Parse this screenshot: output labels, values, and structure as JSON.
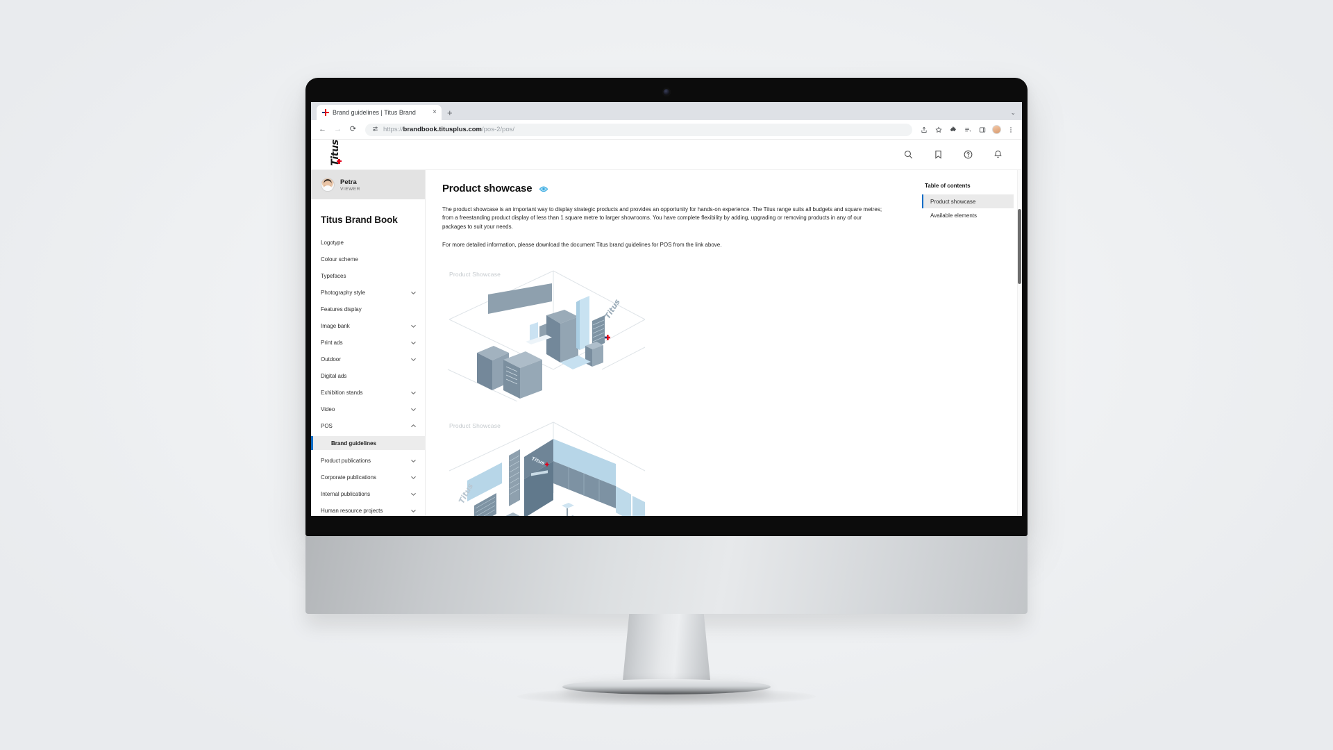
{
  "browser": {
    "tab": {
      "title": "Brand guidelines | Titus Brand",
      "favicon": "titus-cross-favicon",
      "close_label": "×"
    },
    "new_tab_label": "+",
    "tablist_chevron": "⌄",
    "nav": {
      "back": "←",
      "forward": "→",
      "reload": "⟳"
    },
    "omnibox": {
      "site_settings_icon": "tune-icon",
      "url_prefix": "https://",
      "url_domain": "brandbook.titusplus.com",
      "url_path": "/pos-2/pos/"
    },
    "toolbar_icons": [
      {
        "name": "share-icon",
        "glyph": "⇧"
      },
      {
        "name": "bookmark-star-icon",
        "glyph": "☆"
      },
      {
        "name": "extensions-puzzle-icon",
        "glyph": "❖"
      },
      {
        "name": "reading-list-icon",
        "glyph": "≣"
      },
      {
        "name": "side-panel-icon",
        "glyph": "▣"
      },
      {
        "name": "profile-avatar",
        "glyph": ""
      },
      {
        "name": "chrome-menu-icon",
        "glyph": "⋮"
      }
    ]
  },
  "app": {
    "logo_text": "Titus",
    "header_icons": [
      {
        "name": "search-icon"
      },
      {
        "name": "bookmark-icon"
      },
      {
        "name": "help-icon"
      },
      {
        "name": "notification-bell-icon"
      }
    ]
  },
  "sidebar": {
    "user": {
      "name": "Petra",
      "role": "VIEWER"
    },
    "title": "Titus Brand Book",
    "items": [
      {
        "label": "Logotype",
        "expandable": false
      },
      {
        "label": "Colour scheme",
        "expandable": false
      },
      {
        "label": "Typefaces",
        "expandable": false
      },
      {
        "label": "Photography style",
        "expandable": true,
        "expanded": false
      },
      {
        "label": "Features display",
        "expandable": false
      },
      {
        "label": "Image bank",
        "expandable": true,
        "expanded": false
      },
      {
        "label": "Print ads",
        "expandable": true,
        "expanded": false
      },
      {
        "label": "Outdoor",
        "expandable": true,
        "expanded": false
      },
      {
        "label": "Digital ads",
        "expandable": false
      },
      {
        "label": "Exhibition stands",
        "expandable": true,
        "expanded": false
      },
      {
        "label": "Video",
        "expandable": true,
        "expanded": false
      },
      {
        "label": "POS",
        "expandable": true,
        "expanded": true
      }
    ],
    "active_sub_item": "Brand guidelines",
    "items_after": [
      {
        "label": "Product publications",
        "expandable": true,
        "expanded": false
      },
      {
        "label": "Corporate publications",
        "expandable": true,
        "expanded": false
      },
      {
        "label": "Internal publications",
        "expandable": true,
        "expanded": false
      },
      {
        "label": "Human resource projects",
        "expandable": true,
        "expanded": false
      }
    ],
    "chevron_down": "⌄",
    "chevron_up": "⌃"
  },
  "main": {
    "title": "Product showcase",
    "visibility_icon": "eye-icon",
    "paragraph_1": "The product showcase is an important way to display strategic products and provides an opportunity for hands-on experience. The Titus range suits all budgets and square metres; from a freestanding product display of less than 1 square metre to larger showrooms. You have complete flexibility by adding, upgrading or removing products in any of our packages to suit your needs.",
    "paragraph_2": "For more detailed information, please download the document Titus brand guidelines for POS from the link above.",
    "illustrations": [
      {
        "caption": "Product Showcase"
      },
      {
        "caption": "Product Showcase"
      }
    ]
  },
  "toc": {
    "title": "Table of contents",
    "items": [
      {
        "label": "Product showcase",
        "active": true
      },
      {
        "label": "Available elements",
        "active": false
      }
    ]
  },
  "colors": {
    "accent_blue": "#0d6dc7",
    "eye_blue": "#35a8e0",
    "brand_red": "#e2001a",
    "illustration_slate": "#8ea0ae",
    "illustration_light": "#bedaea"
  }
}
